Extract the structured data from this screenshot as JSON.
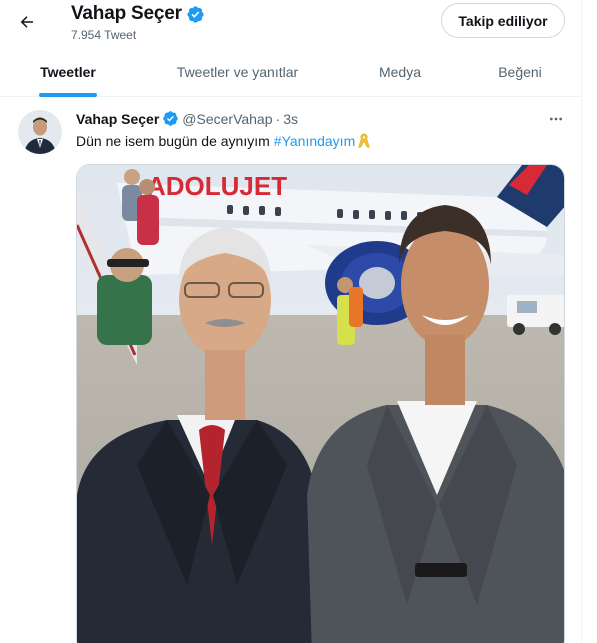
{
  "header": {
    "name": "Vahap Seçer",
    "tweet_count": "7.954 Tweet",
    "follow_label": "Takip ediliyor"
  },
  "tabs": [
    {
      "label": "Tweetler",
      "active": true
    },
    {
      "label": "Tweetler ve yanıtlar",
      "active": false
    },
    {
      "label": "Medya",
      "active": false
    },
    {
      "label": "Beğeni",
      "active": false
    }
  ],
  "tweet": {
    "name": "Vahap Seçer",
    "handle": "@SecerVahap",
    "separator": "·",
    "time": "3s",
    "text": "Dün ne isem bugün de aynıyım",
    "hashtag": "#Yanındayım",
    "photo_sign_text": "ADOLUJET"
  },
  "colors": {
    "accent": "#1d9bf0",
    "verified": "#1d9bf0",
    "ribbon": "#f2c230",
    "text_secondary": "#536471"
  },
  "icons": {
    "back": "arrow-left-icon",
    "verified": "verified-badge-icon",
    "more": "more-horizontal-icon",
    "ribbon": "yellow-ribbon-icon"
  }
}
